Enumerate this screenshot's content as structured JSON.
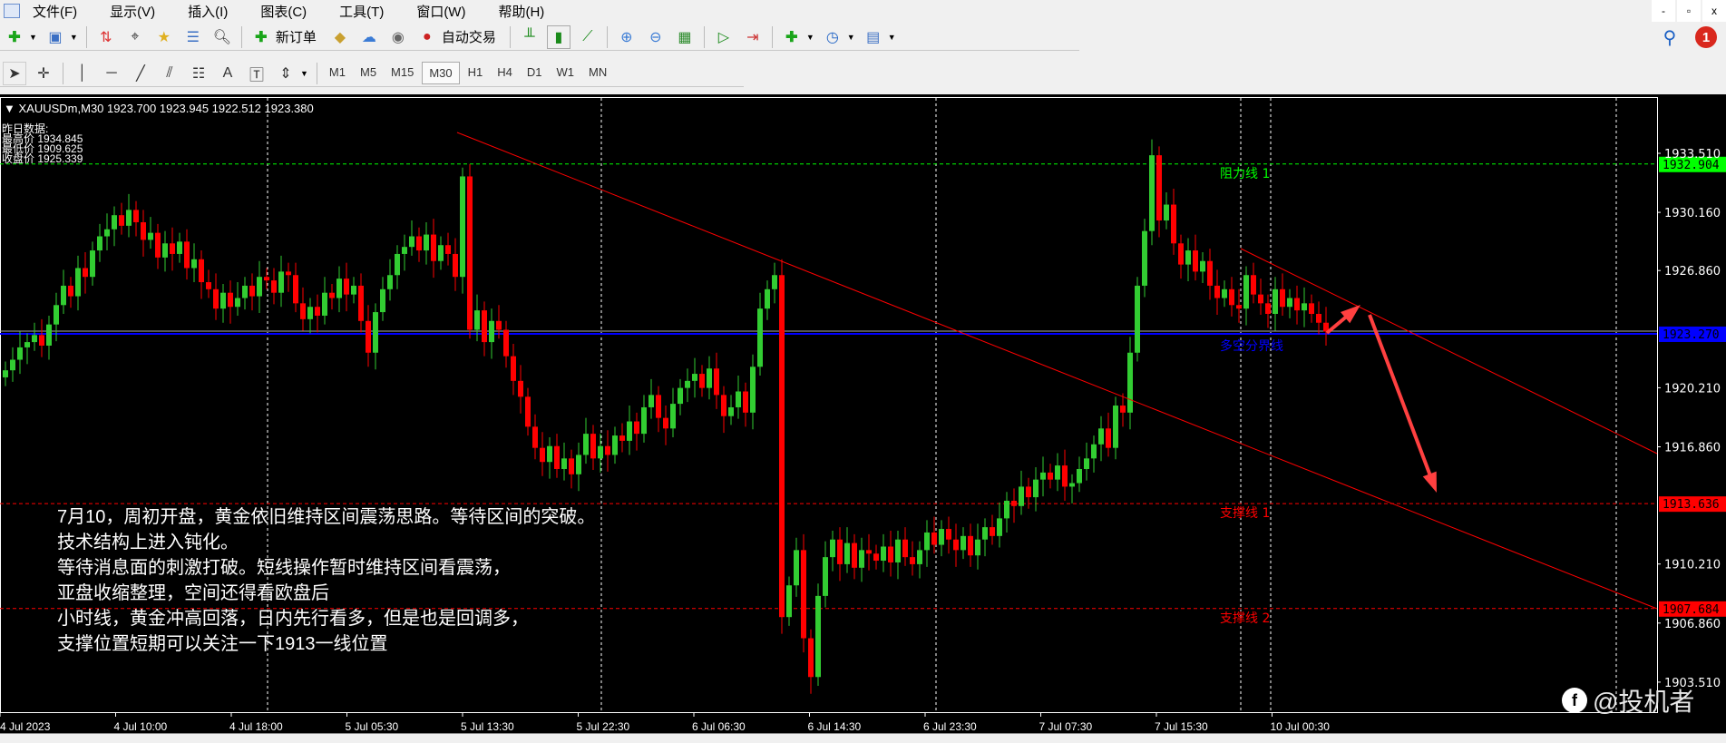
{
  "menu": [
    "文件(F)",
    "显示(V)",
    "插入(I)",
    "图表(C)",
    "工具(T)",
    "窗口(W)",
    "帮助(H)"
  ],
  "window_controls": [
    "-",
    "▫",
    "x"
  ],
  "toolbar": {
    "new_order": "新订单",
    "auto_trade": "自动交易",
    "notification_count": "1"
  },
  "drawing_tools": {
    "text_tool": "A"
  },
  "timeframes": [
    "M1",
    "M5",
    "M15",
    "M30",
    "H1",
    "H4",
    "D1",
    "W1",
    "MN"
  ],
  "active_timeframe": "M30",
  "chart": {
    "header": "XAUUSDm,M30  1923.700 1923.945 1922.512 1923.380",
    "yesterday": {
      "title": "昨日数据:",
      "high": "最高价 1934.845",
      "low": "最低价 1909.625",
      "close": "收盘价 1925.339"
    },
    "price_ticks": [
      "1933.510",
      "1930.160",
      "1926.860",
      "1920.210",
      "1916.860",
      "1910.210",
      "1906.860",
      "1903.510"
    ],
    "time_ticks": [
      "4 Jul 2023",
      "4 Jul 10:00",
      "4 Jul 18:00",
      "5 Jul 05:30",
      "5 Jul 13:30",
      "5 Jul 22:30",
      "6 Jul 06:30",
      "6 Jul 14:30",
      "6 Jul 23:30",
      "7 Jul 07:30",
      "7 Jul 15:30",
      "10 Jul 00:30"
    ],
    "levels": [
      {
        "name": "阻力线 1",
        "price": 1932.904,
        "label": "1932.904",
        "color": "#00ff00",
        "style": "dashed"
      },
      {
        "name": "多空分界线",
        "price": 1923.27,
        "label": "1923.270",
        "color": "#0000ff",
        "style": "solid"
      },
      {
        "name": "支撑线 1",
        "price": 1913.636,
        "label": "1913.636",
        "color": "#ff0000",
        "style": "dashed"
      },
      {
        "name": "支撑线 2",
        "price": 1907.684,
        "label": "1907.684",
        "color": "#ff0000",
        "style": "dashed"
      }
    ],
    "up_color": "#32cd32",
    "down_color": "#ff0000",
    "closes": [
      1921.2,
      1921.8,
      1922.5,
      1922.8,
      1923.2,
      1922.6,
      1923.8,
      1924.9,
      1926.0,
      1925.4,
      1927.0,
      1926.5,
      1928.0,
      1928.8,
      1929.2,
      1930.0,
      1929.4,
      1930.3,
      1929.6,
      1928.6,
      1929.0,
      1927.6,
      1928.4,
      1927.8,
      1928.5,
      1927.0,
      1927.5,
      1926.2,
      1925.8,
      1924.7,
      1925.6,
      1924.8,
      1925.3,
      1926.0,
      1925.4,
      1926.5,
      1926.3,
      1925.6,
      1926.8,
      1926.6,
      1925.0,
      1924.1,
      1924.8,
      1924.3,
      1925.6,
      1925.3,
      1926.4,
      1925.5,
      1926.0,
      1924.0,
      1922.2,
      1924.5,
      1925.8,
      1926.6,
      1927.8,
      1928.2,
      1928.8,
      1928.0,
      1928.9,
      1927.4,
      1928.3,
      1927.8,
      1926.5,
      1932.2,
      1923.5,
      1924.6,
      1922.8,
      1924.0,
      1923.5,
      1922.0,
      1920.6,
      1919.7,
      1918.0,
      1916.8,
      1916.0,
      1916.9,
      1915.6,
      1916.2,
      1915.3,
      1916.4,
      1917.6,
      1916.2,
      1916.9,
      1916.4,
      1917.5,
      1917.2,
      1918.3,
      1917.6,
      1919.1,
      1919.8,
      1918.5,
      1917.9,
      1919.3,
      1920.2,
      1920.6,
      1921.0,
      1920.2,
      1921.3,
      1919.8,
      1918.6,
      1919.1,
      1920.0,
      1918.8,
      1921.4,
      1924.7,
      1925.8,
      1926.6,
      1907.2,
      1909.0,
      1911.0,
      1906.0,
      1903.8,
      1908.4,
      1910.6,
      1911.6,
      1910.2,
      1911.4,
      1910.0,
      1911.0,
      1910.8,
      1910.4,
      1911.2,
      1910.3,
      1911.6,
      1910.6,
      1910.2,
      1911.0,
      1912.0,
      1911.3,
      1912.2,
      1911.6,
      1911.0,
      1911.8,
      1910.7,
      1911.6,
      1912.3,
      1911.8,
      1912.8,
      1913.8,
      1913.5,
      1914.6,
      1914.0,
      1915.0,
      1915.4,
      1915.0,
      1915.8,
      1914.6,
      1914.8,
      1915.6,
      1916.2,
      1917.0,
      1917.9,
      1916.8,
      1919.2,
      1918.8,
      1922.2,
      1926.0,
      1929.1,
      1933.4,
      1929.7,
      1930.6,
      1928.4,
      1927.2,
      1928.0,
      1926.8,
      1927.4,
      1926.0,
      1925.3,
      1925.8,
      1924.9,
      1924.7,
      1926.6,
      1925.5,
      1925.0,
      1924.4,
      1925.8,
      1924.8,
      1925.3,
      1924.6,
      1925.0,
      1924.4,
      1923.9,
      1923.4
    ],
    "note_lines": [
      "7月10，周初开盘，黄金依旧维持区间震荡思路。等待区间的突破。",
      "技术结构上进入钝化。",
      "等待消息面的刺激打破。短线操作暂时维持区间看震荡，",
      "亚盘收缩整理，空间还得看欧盘后",
      "小时线，黄金冲高回落，日内先行看多，但是也是回调多，",
      "支撑位置短期可以关注一下1913一线位置"
    ],
    "watermark": "@投机者"
  }
}
